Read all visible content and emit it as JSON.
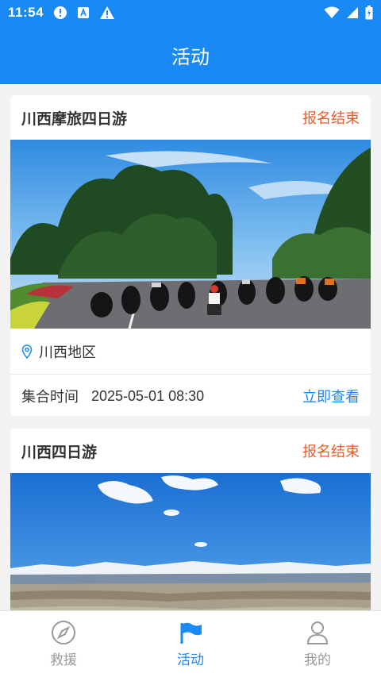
{
  "status_bar": {
    "time": "11:54"
  },
  "app_bar": {
    "title": "活动"
  },
  "activities": [
    {
      "title": "川西摩旅四日游",
      "status": "报名结束",
      "location": "川西地区",
      "time_label": "集合时间",
      "time_value": "2025-05-01 08:30",
      "action": "立即查看"
    },
    {
      "title": "川西四日游",
      "status": "报名结束"
    }
  ],
  "bottom_nav": {
    "items": [
      {
        "label": "救援",
        "icon": "compass-icon"
      },
      {
        "label": "活动",
        "icon": "flag-icon"
      },
      {
        "label": "我的",
        "icon": "user-icon"
      }
    ],
    "active": "活动"
  },
  "colors": {
    "primary": "#1989f3",
    "status_red": "#f05a28"
  }
}
